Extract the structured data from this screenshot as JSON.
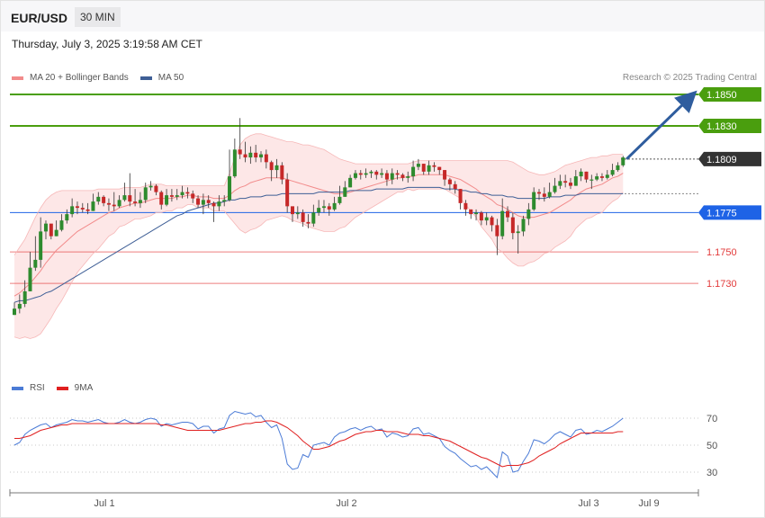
{
  "header": {
    "symbol": "EUR/USD",
    "timeframe": "30 MIN"
  },
  "date": "Thursday, July 3, 2025 3:19:58 AM CET",
  "legend": {
    "ma20_label": "MA 20 + Bollinger Bands",
    "ma50_label": "MA 50",
    "credit": "Research © 2025 Trading Central",
    "ma20_color": "#f28b8b",
    "ma50_color": "#3f5f96"
  },
  "rsi_legend": {
    "rsi_label": "RSI",
    "ma_label": "9MA",
    "rsi_color": "#4b7bd6",
    "ma_color": "#e02020"
  },
  "chart_data": [
    {
      "type": "candlestick",
      "ylim": [
        1.1673,
        1.187
      ],
      "levels": [
        {
          "value": 1.185,
          "label": "1.1850",
          "color": "#4a9e0e",
          "kind": "resistance"
        },
        {
          "value": 1.183,
          "label": "1.1830",
          "color": "#4a9e0e",
          "kind": "resistance"
        },
        {
          "value": 1.1809,
          "label": "1.1809",
          "color": "#333333",
          "kind": "last-price"
        },
        {
          "value": 1.1775,
          "label": "1.1775",
          "color": "#1e63e6",
          "kind": "pivot"
        },
        {
          "value": 1.175,
          "label": "1.1750",
          "color": "#e23a3a",
          "kind": "support"
        },
        {
          "value": 1.173,
          "label": "1.1730",
          "color": "#e23a3a",
          "kind": "support"
        }
      ],
      "x_labels": [
        "Jul 1",
        "Jul 2",
        "Jul 3",
        "Jul 9"
      ],
      "close": [
        1.1714,
        1.1717,
        1.1725,
        1.174,
        1.1745,
        1.1763,
        1.1768,
        1.176,
        1.1764,
        1.177,
        1.1774,
        1.1779,
        1.1778,
        1.1777,
        1.1776,
        1.1782,
        1.1785,
        1.1781,
        1.178,
        1.1779,
        1.1783,
        1.1786,
        1.1782,
        1.1781,
        1.1783,
        1.1791,
        1.1792,
        1.1788,
        1.178,
        1.1786,
        1.1785,
        1.1786,
        1.1788,
        1.1787,
        1.1784,
        1.178,
        1.1783,
        1.1781,
        1.1779,
        1.1782,
        1.1783,
        1.1798,
        1.1815,
        1.1812,
        1.181,
        1.1813,
        1.181,
        1.1812,
        1.1807,
        1.1802,
        1.1805,
        1.1796,
        1.1779,
        1.1774,
        1.1775,
        1.1769,
        1.1768,
        1.1775,
        1.1778,
        1.1779,
        1.1777,
        1.1781,
        1.1785,
        1.1791,
        1.1797,
        1.18,
        1.1799,
        1.18,
        1.1801,
        1.1799,
        1.18,
        1.1796,
        1.18,
        1.1799,
        1.1797,
        1.1798,
        1.1804,
        1.1806,
        1.1801,
        1.1805,
        1.1804,
        1.1802,
        1.1796,
        1.1793,
        1.179,
        1.1781,
        1.1777,
        1.1774,
        1.1775,
        1.177,
        1.1772,
        1.1767,
        1.176,
        1.1776,
        1.1772,
        1.1762,
        1.1763,
        1.1771,
        1.1777,
        1.1788,
        1.1787,
        1.1785,
        1.1788,
        1.1792,
        1.1795,
        1.1794,
        1.1792,
        1.1798,
        1.1801,
        1.1796,
        1.1796,
        1.1798,
        1.1797,
        1.1799,
        1.1802,
        1.1805,
        1.181
      ],
      "high": [
        1.1718,
        1.1723,
        1.1732,
        1.175,
        1.176,
        1.1772,
        1.177,
        1.1766,
        1.177,
        1.1774,
        1.1777,
        1.1784,
        1.1782,
        1.1781,
        1.1781,
        1.1787,
        1.1788,
        1.1786,
        1.1784,
        1.1788,
        1.1786,
        1.1794,
        1.18,
        1.179,
        1.1788,
        1.1794,
        1.1795,
        1.1793,
        1.1789,
        1.179,
        1.179,
        1.179,
        1.1792,
        1.1791,
        1.1789,
        1.1786,
        1.1787,
        1.1786,
        1.1782,
        1.1786,
        1.1786,
        1.1815,
        1.1822,
        1.1835,
        1.182,
        1.1817,
        1.1818,
        1.1814,
        1.1815,
        1.1808,
        1.1809,
        1.1807,
        1.18,
        1.1778,
        1.1779,
        1.1777,
        1.1774,
        1.178,
        1.1783,
        1.1783,
        1.1781,
        1.1785,
        1.1792,
        1.1795,
        1.1799,
        1.1802,
        1.1802,
        1.1803,
        1.1802,
        1.1802,
        1.1803,
        1.1802,
        1.1803,
        1.1802,
        1.18,
        1.1801,
        1.1808,
        1.1809,
        1.1806,
        1.1808,
        1.1807,
        1.1804,
        1.1802,
        1.1797,
        1.1795,
        1.179,
        1.1783,
        1.1777,
        1.1777,
        1.1776,
        1.1775,
        1.1773,
        1.1771,
        1.1784,
        1.1779,
        1.1775,
        1.1767,
        1.1773,
        1.1781,
        1.1791,
        1.179,
        1.1791,
        1.1794,
        1.1797,
        1.1799,
        1.1799,
        1.1797,
        1.1802,
        1.1803,
        1.1801,
        1.1799,
        1.18,
        1.18,
        1.1802,
        1.1806,
        1.1807,
        1.1811
      ],
      "low": [
        1.171,
        1.1711,
        1.1715,
        1.1725,
        1.1738,
        1.174,
        1.1758,
        1.1758,
        1.176,
        1.1763,
        1.1768,
        1.1772,
        1.1774,
        1.1775,
        1.1774,
        1.1776,
        1.178,
        1.1779,
        1.1776,
        1.1776,
        1.1778,
        1.1782,
        1.1779,
        1.1779,
        1.1778,
        1.1781,
        1.1789,
        1.1786,
        1.1777,
        1.1779,
        1.1782,
        1.1783,
        1.1784,
        1.1784,
        1.1781,
        1.1778,
        1.1774,
        1.1778,
        1.1769,
        1.1776,
        1.1779,
        1.1782,
        1.1797,
        1.1809,
        1.1807,
        1.1806,
        1.1807,
        1.1807,
        1.1803,
        1.1795,
        1.1797,
        1.1793,
        1.1775,
        1.1769,
        1.1771,
        1.1766,
        1.1765,
        1.1766,
        1.1773,
        1.1775,
        1.1773,
        1.1776,
        1.178,
        1.1785,
        1.1791,
        1.1796,
        1.1796,
        1.1797,
        1.1797,
        1.1796,
        1.1797,
        1.1792,
        1.1793,
        1.1796,
        1.1795,
        1.1794,
        1.1795,
        1.1802,
        1.1799,
        1.1799,
        1.1801,
        1.1799,
        1.1792,
        1.1789,
        1.1787,
        1.1777,
        1.1773,
        1.1771,
        1.177,
        1.1767,
        1.1767,
        1.1763,
        1.1748,
        1.1758,
        1.1769,
        1.1758,
        1.1749,
        1.176,
        1.1767,
        1.1776,
        1.1783,
        1.1782,
        1.1784,
        1.1787,
        1.179,
        1.1791,
        1.179,
        1.1792,
        1.1795,
        1.1794,
        1.179,
        1.1795,
        1.1795,
        1.1796,
        1.1798,
        1.1801,
        1.1804
      ],
      "ma20": [
        1.1722,
        1.1724,
        1.1727,
        1.173,
        1.1734,
        1.1738,
        1.1743,
        1.1747,
        1.1751,
        1.1754,
        1.1757,
        1.176,
        1.1763,
        1.1765,
        1.1767,
        1.1769,
        1.1771,
        1.1773,
        1.1775,
        1.1776,
        1.1778,
        1.1779,
        1.178,
        1.1781,
        1.1781,
        1.1782,
        1.1783,
        1.1784,
        1.1784,
        1.1784,
        1.1784,
        1.1785,
        1.1785,
        1.1786,
        1.1786,
        1.1785,
        1.1785,
        1.1785,
        1.1784,
        1.1784,
        1.1784,
        1.1786,
        1.1789,
        1.1791,
        1.1792,
        1.1794,
        1.1795,
        1.1796,
        1.1797,
        1.1797,
        1.1797,
        1.1797,
        1.1796,
        1.1795,
        1.1794,
        1.1793,
        1.1792,
        1.1791,
        1.179,
        1.1789,
        1.1788,
        1.1787,
        1.1787,
        1.1787,
        1.1788,
        1.1789,
        1.179,
        1.1791,
        1.1792,
        1.1793,
        1.1794,
        1.1795,
        1.1796,
        1.1797,
        1.1797,
        1.1798,
        1.1798,
        1.1799,
        1.1799,
        1.1799,
        1.1799,
        1.1799,
        1.1799,
        1.1798,
        1.1797,
        1.1796,
        1.1794,
        1.1792,
        1.179,
        1.1787,
        1.1785,
        1.1783,
        1.178,
        1.1779,
        1.1777,
        1.1775,
        1.1773,
        1.1772,
        1.1772,
        1.1772,
        1.1773,
        1.1774,
        1.1775,
        1.1777,
        1.1779,
        1.1781,
        1.1783,
        1.1786,
        1.1788,
        1.179,
        1.1791,
        1.1792,
        1.1793,
        1.1795,
        1.1797,
        1.1798,
        1.18
      ],
      "bb_upper": [
        1.1748,
        1.1753,
        1.1758,
        1.1765,
        1.1772,
        1.1778,
        1.1783,
        1.1786,
        1.1788,
        1.1789,
        1.1789,
        1.1789,
        1.1789,
        1.1789,
        1.1789,
        1.1789,
        1.179,
        1.179,
        1.179,
        1.179,
        1.179,
        1.1791,
        1.1791,
        1.1791,
        1.1791,
        1.1792,
        1.1793,
        1.1793,
        1.1793,
        1.1792,
        1.1792,
        1.1792,
        1.1792,
        1.1792,
        1.1792,
        1.1792,
        1.1792,
        1.1792,
        1.1792,
        1.1792,
        1.1792,
        1.18,
        1.181,
        1.1818,
        1.1822,
        1.1824,
        1.1825,
        1.1825,
        1.1824,
        1.1823,
        1.1822,
        1.1821,
        1.182,
        1.182,
        1.1819,
        1.1818,
        1.1818,
        1.1817,
        1.1816,
        1.1815,
        1.1813,
        1.1811,
        1.1809,
        1.1808,
        1.1807,
        1.1806,
        1.1806,
        1.1806,
        1.1806,
        1.1806,
        1.1806,
        1.1806,
        1.1806,
        1.1806,
        1.1806,
        1.1806,
        1.1807,
        1.1808,
        1.1808,
        1.1808,
        1.1808,
        1.1808,
        1.1808,
        1.1808,
        1.1808,
        1.1808,
        1.1808,
        1.1808,
        1.1808,
        1.1808,
        1.1808,
        1.1808,
        1.1808,
        1.1808,
        1.1808,
        1.1807,
        1.1805,
        1.1803,
        1.1801,
        1.18,
        1.1799,
        1.1799,
        1.18,
        1.1801,
        1.1803,
        1.1805,
        1.1806,
        1.1807,
        1.1808,
        1.1809,
        1.181,
        1.181,
        1.1811,
        1.1811,
        1.1812,
        1.1812,
        1.1812
      ],
      "bb_lower": [
        1.1696,
        1.1695,
        1.1696,
        1.1695,
        1.1696,
        1.1698,
        1.1703,
        1.1708,
        1.1714,
        1.1719,
        1.1725,
        1.1731,
        1.1737,
        1.1741,
        1.1745,
        1.1749,
        1.1752,
        1.1756,
        1.176,
        1.1762,
        1.1766,
        1.1767,
        1.1769,
        1.1771,
        1.1771,
        1.1772,
        1.1773,
        1.1775,
        1.1775,
        1.1776,
        1.1776,
        1.1778,
        1.1778,
        1.178,
        1.178,
        1.1778,
        1.1778,
        1.1778,
        1.1776,
        1.1776,
        1.1776,
        1.1772,
        1.1768,
        1.1764,
        1.1762,
        1.1764,
        1.1765,
        1.1767,
        1.177,
        1.1771,
        1.1772,
        1.1773,
        1.1772,
        1.177,
        1.1769,
        1.1768,
        1.1766,
        1.1765,
        1.1764,
        1.1763,
        1.1763,
        1.1763,
        1.1765,
        1.1766,
        1.1769,
        1.1772,
        1.1774,
        1.1776,
        1.1778,
        1.178,
        1.1782,
        1.1784,
        1.1786,
        1.1788,
        1.1788,
        1.179,
        1.1789,
        1.179,
        1.179,
        1.179,
        1.179,
        1.179,
        1.179,
        1.1788,
        1.1786,
        1.1784,
        1.178,
        1.1776,
        1.1772,
        1.1766,
        1.1762,
        1.1758,
        1.1752,
        1.175,
        1.1746,
        1.1743,
        1.1741,
        1.1741,
        1.1743,
        1.1744,
        1.1746,
        1.1749,
        1.175,
        1.1753,
        1.1755,
        1.1757,
        1.176,
        1.1765,
        1.1768,
        1.1771,
        1.1772,
        1.1774,
        1.1775,
        1.1779,
        1.1782,
        1.1784,
        1.1788
      ],
      "ma50": [
        1.1718,
        1.1719,
        1.1719,
        1.172,
        1.1721,
        1.1722,
        1.1724,
        1.1725,
        1.1727,
        1.1729,
        1.1731,
        1.1733,
        1.1735,
        1.1737,
        1.1739,
        1.1741,
        1.1743,
        1.1745,
        1.1747,
        1.1749,
        1.1751,
        1.1753,
        1.1755,
        1.1757,
        1.1759,
        1.1761,
        1.1763,
        1.1765,
        1.1767,
        1.1769,
        1.1771,
        1.1773,
        1.1774,
        1.1776,
        1.1777,
        1.1778,
        1.1779,
        1.178,
        1.1781,
        1.1781,
        1.1782,
        1.1783,
        1.1783,
        1.1784,
        1.1784,
        1.1785,
        1.1785,
        1.1785,
        1.1786,
        1.1786,
        1.1786,
        1.1787,
        1.1787,
        1.1787,
        1.1787,
        1.1787,
        1.1787,
        1.1787,
        1.1788,
        1.1788,
        1.1788,
        1.1788,
        1.1788,
        1.1788,
        1.1789,
        1.1789,
        1.1789,
        1.1789,
        1.1789,
        1.179,
        1.179,
        1.179,
        1.179,
        1.179,
        1.179,
        1.1791,
        1.1791,
        1.1791,
        1.1791,
        1.1791,
        1.1791,
        1.1791,
        1.179,
        1.179,
        1.179,
        1.1789,
        1.1789,
        1.1788,
        1.1788,
        1.1787,
        1.1787,
        1.1786,
        1.1786,
        1.1786,
        1.1785,
        1.1785,
        1.1784,
        1.1784,
        1.1784,
        1.1784,
        1.1784,
        1.1784,
        1.1785,
        1.1785,
        1.1785,
        1.1786,
        1.1786,
        1.1786,
        1.1787,
        1.1787,
        1.1787,
        1.1787,
        1.1787,
        1.1787,
        1.1787,
        1.1787,
        1.1787
      ],
      "projection": {
        "from": 1.1809,
        "to": 1.185
      }
    },
    {
      "type": "line",
      "ylim": [
        20,
        80
      ],
      "yticks": [
        70,
        50,
        30
      ],
      "series": [
        {
          "name": "RSI",
          "values": [
            50,
            52,
            58,
            61,
            63,
            65,
            66,
            63,
            65,
            66,
            67,
            69,
            68,
            68,
            67,
            68,
            69,
            67,
            66,
            66,
            67,
            69,
            67,
            66,
            67,
            69,
            70,
            69,
            64,
            66,
            65,
            66,
            67,
            67,
            66,
            62,
            64,
            64,
            59,
            62,
            63,
            72,
            75,
            74,
            73,
            74,
            71,
            72,
            67,
            63,
            65,
            55,
            36,
            32,
            33,
            43,
            41,
            50,
            51,
            52,
            50,
            56,
            59,
            60,
            62,
            63,
            61,
            63,
            64,
            61,
            62,
            56,
            59,
            58,
            56,
            57,
            62,
            63,
            58,
            59,
            57,
            55,
            49,
            46,
            44,
            40,
            37,
            34,
            35,
            32,
            34,
            30,
            26,
            45,
            42,
            30,
            31,
            38,
            44,
            54,
            53,
            51,
            54,
            58,
            60,
            58,
            56,
            61,
            62,
            58,
            59,
            61,
            60,
            62,
            64,
            67,
            70
          ]
        },
        {
          "name": "9MA",
          "values": [
            55,
            55,
            56,
            57,
            59,
            61,
            62,
            63,
            64,
            65,
            65,
            66,
            66,
            66,
            66,
            66,
            66,
            66,
            66,
            66,
            66,
            66,
            66,
            66,
            66,
            66,
            66,
            66,
            65,
            65,
            64,
            63,
            62,
            61,
            61,
            61,
            61,
            61,
            61,
            61,
            62,
            63,
            64,
            65,
            66,
            66,
            67,
            67,
            68,
            68,
            67,
            65,
            63,
            60,
            57,
            53,
            50,
            47,
            47,
            48,
            49,
            51,
            53,
            54,
            56,
            58,
            59,
            60,
            60,
            61,
            61,
            60,
            60,
            60,
            59,
            58,
            58,
            58,
            57,
            57,
            56,
            55,
            54,
            53,
            51,
            49,
            47,
            45,
            43,
            41,
            40,
            38,
            36,
            34,
            35,
            35,
            35,
            36,
            37,
            39,
            42,
            44,
            46,
            48,
            51,
            53,
            55,
            57,
            59,
            59,
            59,
            59,
            59,
            59,
            59,
            60,
            60
          ]
        }
      ]
    }
  ]
}
